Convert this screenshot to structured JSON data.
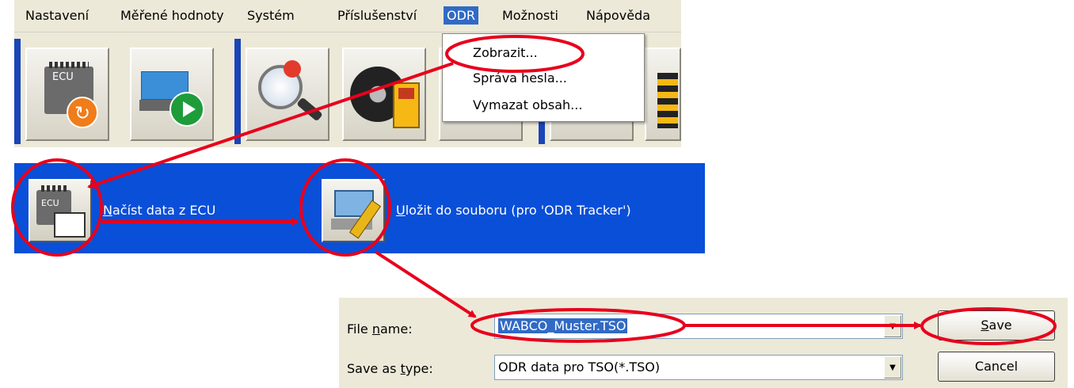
{
  "menu": {
    "items": [
      "Nastavení",
      "Měřené hodnoty",
      "Systém",
      "Příslušenství",
      "ODR",
      "Možnosti",
      "Nápověda"
    ],
    "active": "ODR"
  },
  "toolbar": {
    "ecu_chip_text": "ECU",
    "buttons": [
      "ecu-reset",
      "vehicle-start",
      "diagnose",
      "tire-meter",
      "truck-partial"
    ]
  },
  "odr_menu": {
    "items": [
      "Zobrazit...",
      "Správa hesla...",
      "Vymazat obsah..."
    ]
  },
  "odr_panel": {
    "read_label_first": "N",
    "read_label_rest": "ačíst data z ECU",
    "save_label_first": "U",
    "save_label_rest": "ložit do souboru (pro 'ODR Tracker')",
    "ecu_chip_text": "ECU"
  },
  "dialog": {
    "file_name_label_pre": "File ",
    "file_name_label_u": "n",
    "file_name_label_post": "ame:",
    "file_name_value": "WABCO_Muster.TSO",
    "save_type_label_pre": "Save as ",
    "save_type_label_u": "t",
    "save_type_label_post": "ype:",
    "save_type_value": "ODR data pro TSO(*.TSO)",
    "save_button_u": "S",
    "save_button_rest": "ave",
    "cancel_button": "Cancel"
  },
  "colors": {
    "annotation": "#e8001c",
    "odr_panel_bg": "#0a4fd8",
    "selection": "#316ac5"
  }
}
